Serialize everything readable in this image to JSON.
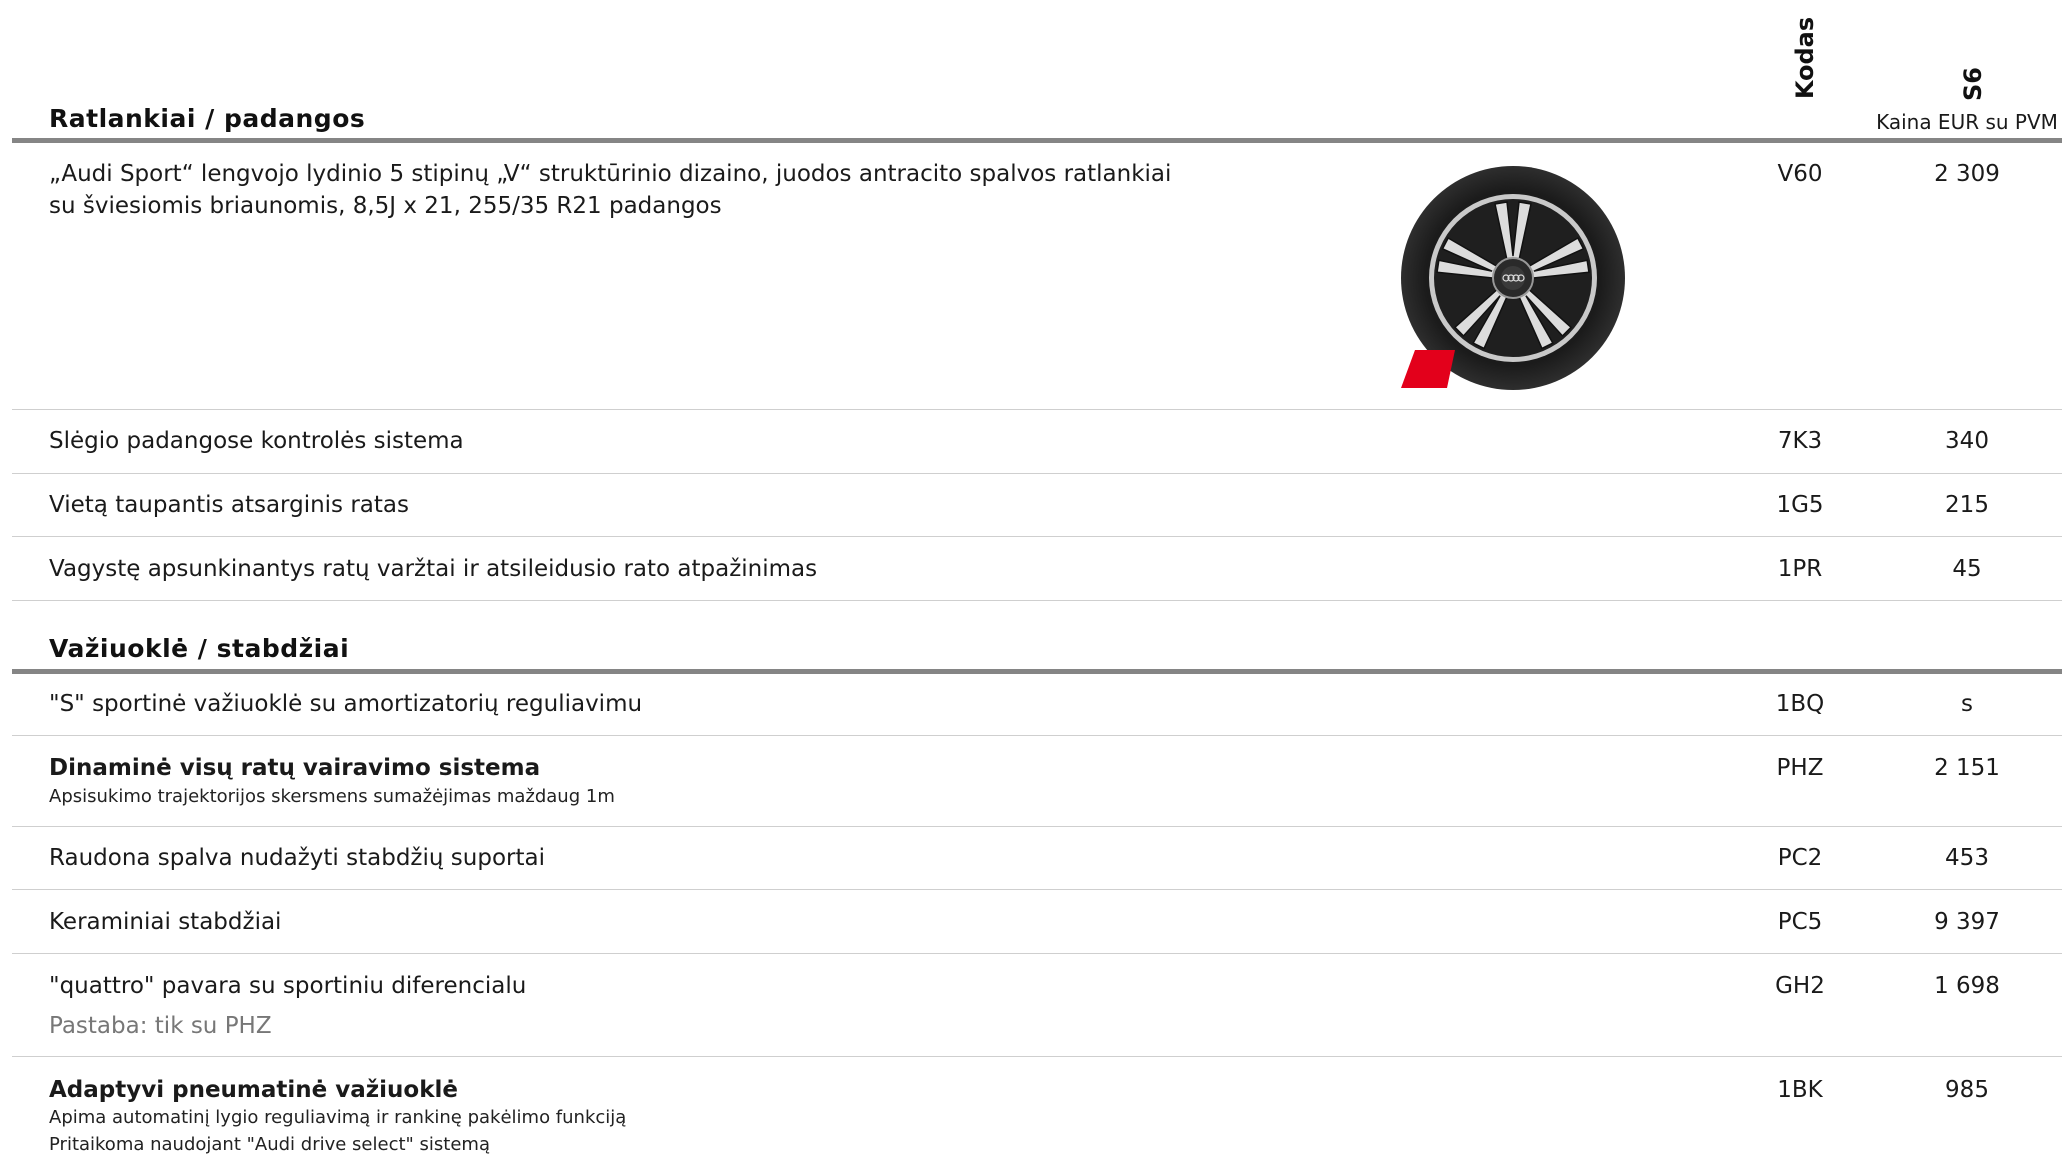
{
  "header": {
    "code_col": "Kodas",
    "model_col": "S6",
    "price_note": "Kaina EUR su PVM"
  },
  "sections": [
    {
      "title": "Ratlankiai / padangos",
      "rows": [
        {
          "text_line1": "„Audi Sport“ lengvojo lydinio 5 stipinų „V“ struktūrinio dizaino, juodos antracito spalvos ratlankiai",
          "text_line2": "su šviesiomis briaunomis, 8,5J x 21, 255/35 R21 padangos",
          "code": "V60",
          "price": "2 309",
          "image": "wheel-rim-image"
        },
        {
          "text": "Slėgio padangose kontrolės sistema",
          "code": "7K3",
          "price": "340"
        },
        {
          "text": "Vietą taupantis atsarginis ratas",
          "code": "1G5",
          "price": "215"
        },
        {
          "text": "Vagystę apsunkinantys ratų varžtai ir atsileidusio rato atpažinimas",
          "code": "1PR",
          "price": "45"
        }
      ]
    },
    {
      "title": "Važiuoklė / stabdžiai",
      "rows": [
        {
          "text": "\"S\" sportinė važiuoklė su amortizatorių reguliavimu",
          "code": "1BQ",
          "price": "s"
        },
        {
          "text": "Dinaminė visų ratų vairavimo sistema",
          "sub": "Apsisukimo trajektorijos skersmens sumažėjimas maždaug 1m",
          "code": "PHZ",
          "price": "2 151"
        },
        {
          "text": "Raudona spalva nudažyti stabdžių suportai",
          "code": "PC2",
          "price": "453"
        },
        {
          "text": "Keraminiai stabdžiai",
          "code": "PC5",
          "price": "9 397"
        },
        {
          "text": "\"quattro\" pavara su sportiniu diferencialu",
          "note": "Pastaba: tik su PHZ",
          "code": "GH2",
          "price": "1 698"
        },
        {
          "text": "Adaptyvi pneumatinė važiuoklė",
          "sub1": "Apima automatinį lygio reguliavimą ir rankinę pakėlimo funkciją",
          "sub2": "Pritaikoma naudojant \"Audi drive select\" sistemą",
          "code": "1BK",
          "price": "985"
        }
      ]
    }
  ],
  "colors": {
    "rule_dark": "#858585",
    "rule_light": "#cfcfcf",
    "accent_red": "#e3001b"
  }
}
